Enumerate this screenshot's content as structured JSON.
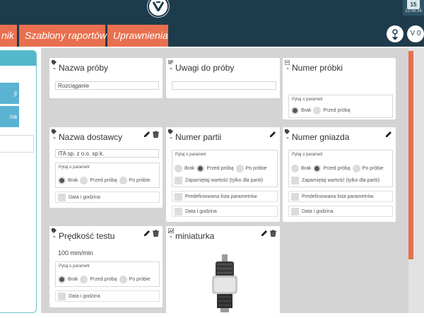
{
  "header": {
    "clock_day": "15",
    "clock_time": "12:06:34"
  },
  "tabs": [
    {
      "label": "nik"
    },
    {
      "label": "Szablony raportów"
    },
    {
      "label": "Uprawnienia"
    }
  ],
  "header_buttons": {
    "help_icon": "gear-dropdown-icon",
    "version_label": "V 0"
  },
  "sidebar": {
    "items": [
      {
        "label": "ji"
      },
      {
        "label": "na"
      }
    ]
  },
  "cards": {
    "nazwa_proby": {
      "title": "Nazwa próby",
      "value": "Rozciąganie"
    },
    "uwagi": {
      "title": "Uwagi do próby",
      "value": ""
    },
    "numer_probki": {
      "title": "Numer próbki",
      "value": "",
      "param_label": "Pytaj o parametr",
      "radio": [
        "Brak",
        "Przed próbą"
      ]
    },
    "nazwa_dostawcy": {
      "title": "Nazwa dostawcy",
      "value": "ITA sp. z o.o. sp.k.",
      "param_label": "Pytaj o parametr",
      "radio": [
        "Brak",
        "Przed próbą",
        "Po próbie"
      ],
      "checkbox": "Data i godzina"
    },
    "numer_partii": {
      "title": "Numer partii",
      "param_label": "Pytaj o parametr",
      "radio": [
        "Brak",
        "Przed próbą",
        "Po próbie"
      ],
      "remember": "Zapamiętaj wartość (tylko dla partii)",
      "predefined": "Predefiniowana lista parametrów",
      "checkbox": "Data i godzina"
    },
    "numer_gniazda": {
      "title": "Numer gniazda",
      "param_label": "Pytaj o parametr",
      "radio": [
        "Brak",
        "Przed próbą",
        "Po próbie"
      ],
      "remember": "Zapamiętaj wartość (tylko dla partii)",
      "predefined": "Predefiniowana lista parametrów",
      "checkbox": "Data i godzina"
    },
    "predkosc": {
      "title": "Prędkość testu",
      "value": "100 mm/min",
      "param_label": "Pytaj o parametr",
      "radio": [
        "Brak",
        "Przed próbą",
        "Po próbie"
      ],
      "checkbox": "Data i godzina"
    },
    "miniaturka": {
      "title": "miniaturka"
    }
  },
  "colors": {
    "topbar": "#1e3b4c",
    "tab": "#e8704f",
    "sidebar_accent": "#53b8c9",
    "workspace": "#d4d4d4"
  }
}
